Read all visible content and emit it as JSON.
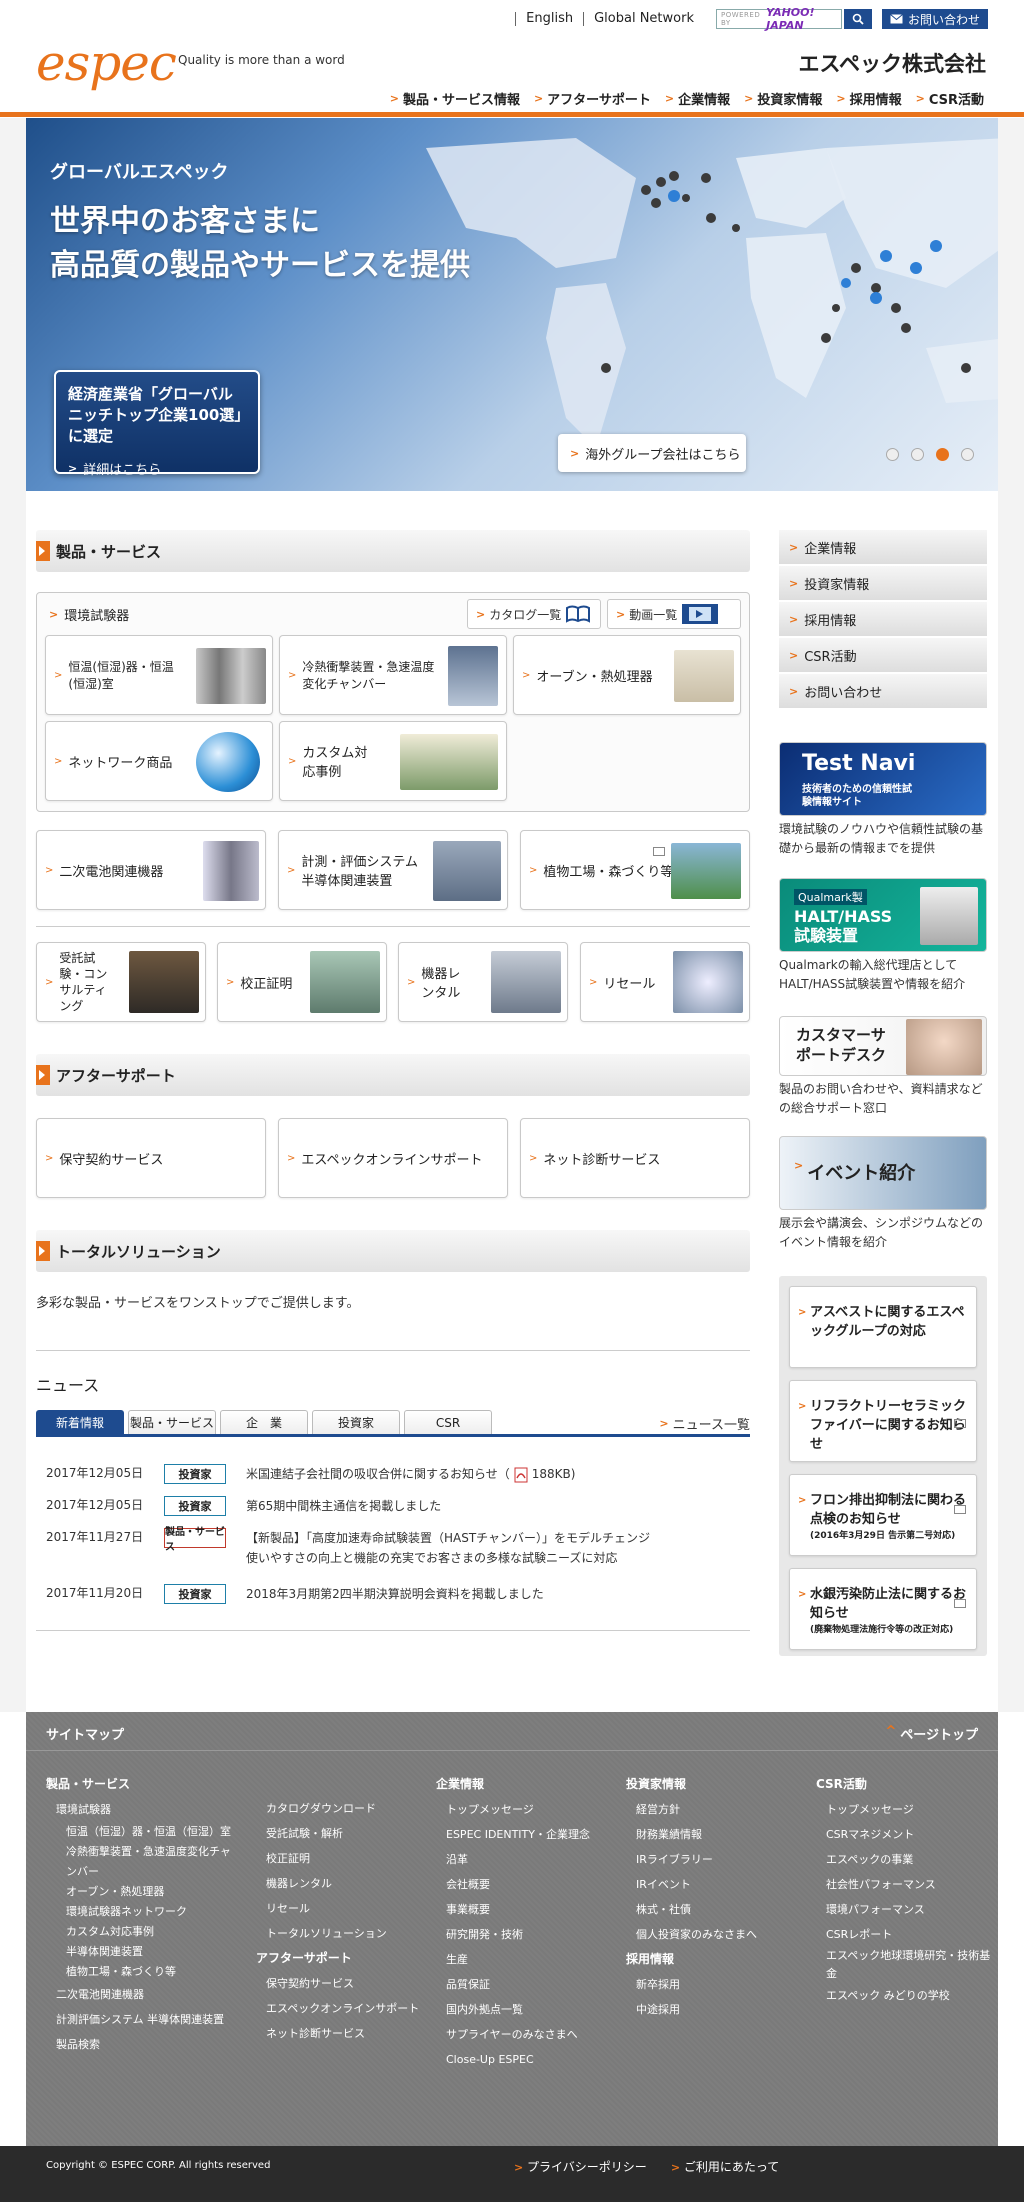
{
  "header": {
    "util_links": [
      "English",
      "Global Network"
    ],
    "search_placeholder": "POWERED BY",
    "search_brand": "YAHOO! JAPAN",
    "contact": "お問い合わせ",
    "logo": "espec",
    "tagline": "Quality is more than a word",
    "company": "エスペック株式会社",
    "nav": [
      "製品・サービス情報",
      "アフターサポート",
      "企業情報",
      "投資家情報",
      "採用情報",
      "CSR活動"
    ]
  },
  "hero": {
    "eyebrow": "グローバルエスペック",
    "title_line1": "世界中のお客さまに",
    "title_line2": "高品質の製品やサービスを提供",
    "award_title": "経済産業省「グローバルニッチトップ企業100選」に選定",
    "award_link": "詳細はこちら",
    "group_link": "海外グループ会社はこちら",
    "slide_count": 4,
    "active_slide": 3
  },
  "products": {
    "heading": "製品・サービス",
    "env_title": "環境試験器",
    "catalog_btn": "カタログ一覧",
    "video_btn": "動画一覧",
    "env_items": [
      "恒温(恒湿)器・恒温(恒湿)室",
      "冷熱衝撃装置・急速温度変化チャンバー",
      "オーブン・熱処理器",
      "ネットワーク商品",
      "カスタム対応事例"
    ],
    "row2": [
      "二次電池関連機器",
      "計測・評価システム半導体関連装置",
      "植物工場・森づくり等"
    ],
    "row3": [
      "受託試験・コンサルティング",
      "校正証明",
      "機器レンタル",
      "リセール"
    ]
  },
  "after": {
    "heading": "アフターサポート",
    "items": [
      "保守契約サービス",
      "エスペックオンラインサポート",
      "ネット診断サービス"
    ]
  },
  "total": {
    "heading": "トータルソリューション",
    "desc": "多彩な製品・サービスをワンストップでご提供します。"
  },
  "news": {
    "title": "ニュース",
    "tabs": [
      "新着情報",
      "製品・サービス",
      "企　業",
      "投資家",
      "CSR"
    ],
    "all": "ニュース一覧",
    "items": [
      {
        "date": "2017年12月05日",
        "cat": "投資家",
        "text": "米国連結子会社間の吸収合併に関するお知らせ（",
        "size": "188KB)"
      },
      {
        "date": "2017年12月05日",
        "cat": "投資家",
        "text": "第65期中間株主通信を掲載しました"
      },
      {
        "date": "2017年11月27日",
        "cat": "製品・サービス",
        "text": "【新製品】「高度加速寿命試験装置（HASTチャンバー）」をモデルチェンジ",
        "text2": "使いやすさの向上と機能の充実でお客さまの多様な試験ニーズに対応"
      },
      {
        "date": "2017年11月20日",
        "cat": "投資家",
        "text": "2018年3月期第2四半期決算説明会資料を掲載しました"
      }
    ]
  },
  "side": {
    "nav": [
      "企業情報",
      "投資家情報",
      "採用情報",
      "CSR活動",
      "お問い合わせ"
    ],
    "testnavi_title": "Test Navi",
    "testnavi_sub": "技術者のための信頼性試験情報サイト",
    "testnavi_cap": "環境試験のノウハウや信頼性試験の基礎から最新の情報までを提供",
    "qualmark_small": "Qualmark製",
    "qualmark_title": "HALT/HASS試験装置",
    "qualmark_cap": "Qualmarkの輸入総代理店としてHALT/HASS試験装置や情報を紹介",
    "cs_title": "カスタマーサポートデスク",
    "cs_cap": "製品のお問い合わせや、資料請求などの総合サポート窓口",
    "event_title": "イベント紹介",
    "event_cap": "展示会や講演会、シンポジウムなどのイベント情報を紹介",
    "notices": [
      {
        "text": "アスベストに関するエスペックグループの対応",
        "small": ""
      },
      {
        "text": "リフラクトリーセラミックファイバーに関するお知らせ",
        "small": ""
      },
      {
        "text": "フロン排出抑制法に関わる点検のお知らせ",
        "small": "(2016年3月29日 告示第二号対応)"
      },
      {
        "text": "水銀汚染防止法に関するお知らせ",
        "small": "(廃棄物処理法施行令等の改正対応)"
      }
    ]
  },
  "footer": {
    "sitemap": "サイトマップ",
    "pagetop": "ページトップ",
    "col1": {
      "head": "製品・サービス",
      "sub": "環境試験器",
      "items": [
        "恒温（恒湿）器・恒温（恒湿）室",
        "冷熱衝撃装置・急速温度変化チャンバー",
        "オーブン・熱処理器",
        "環境試験器ネットワーク",
        "カスタム対応事例",
        "半導体関連装置",
        "植物工場・森づくり等"
      ],
      "tail": [
        "二次電池関連機器",
        "計測評価システム 半導体関連装置",
        "製品検索"
      ]
    },
    "col2": {
      "items": [
        "カタログダウンロード",
        "受託試験・解析",
        "校正証明",
        "機器レンタル",
        "リセール",
        "トータルソリューション"
      ],
      "head": "アフターサポート",
      "items2": [
        "保守契約サービス",
        "エスペックオンラインサポート",
        "ネット診断サービス"
      ]
    },
    "col3": {
      "head": "企業情報",
      "items": [
        "トップメッセージ",
        "ESPEC IDENTITY・企業理念",
        "沿革",
        "会社概要",
        "事業概要",
        "研究開発・技術",
        "生産",
        "品質保証",
        "国内外拠点一覧",
        "サプライヤーのみなさまへ",
        "Close-Up ESPEC"
      ]
    },
    "col4": {
      "head": "投資家情報",
      "items": [
        "経営方針",
        "財務業績情報",
        "IRライブラリー",
        "IRイベント",
        "株式・社債",
        "個人投資家のみなさまへ"
      ],
      "head2": "採用情報",
      "items2": [
        "新卒採用",
        "中途採用"
      ]
    },
    "col5": {
      "head": "CSR活動",
      "items": [
        "トップメッセージ",
        "CSRマネジメント",
        "エスペックの事業",
        "社会性パフォーマンス",
        "環境パフォーマンス",
        "CSRレポート",
        "エスペック地球環境研究・技術基金",
        "エスペック みどりの学校"
      ]
    },
    "copyright": "Copyright © ESPEC CORP. All rights reserved",
    "links": [
      "プライバシーポリシー",
      "ご利用にあたって"
    ]
  }
}
